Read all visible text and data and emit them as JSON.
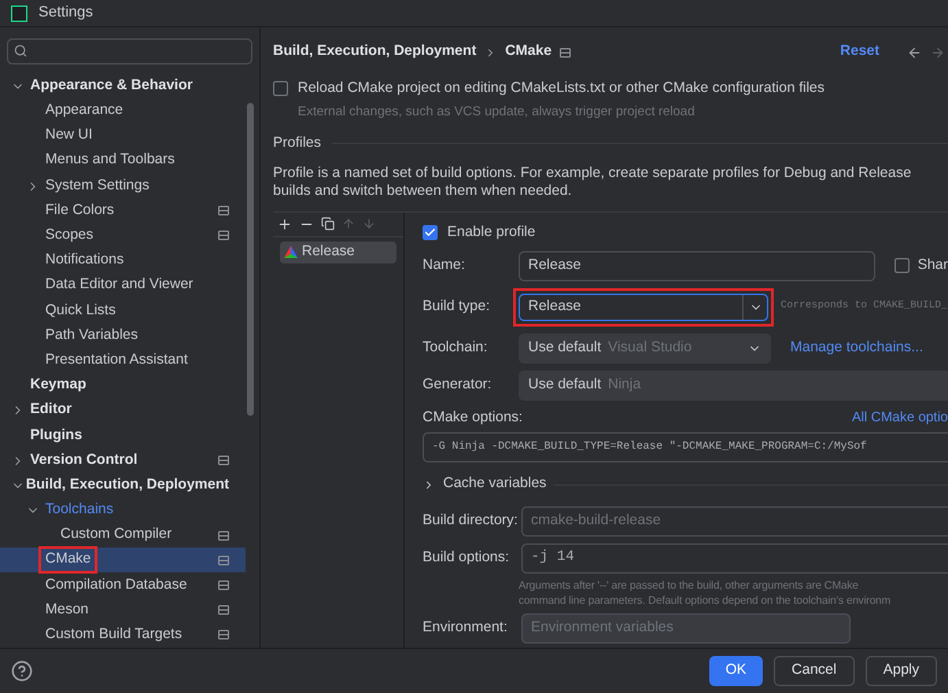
{
  "window": {
    "title": "Settings"
  },
  "sidebar": {
    "items": [
      {
        "label": "Appearance & Behavior",
        "bold": true,
        "expanded": true,
        "selected": false,
        "project": false,
        "children": [
          {
            "label": "Appearance",
            "selected": false,
            "project": false
          },
          {
            "label": "New UI",
            "selected": false,
            "project": false
          },
          {
            "label": "Menus and Toolbars",
            "selected": false,
            "project": false
          },
          {
            "label": "System Settings",
            "expanded": false,
            "selected": false,
            "project": false
          },
          {
            "label": "File Colors",
            "selected": false,
            "project": true
          },
          {
            "label": "Scopes",
            "selected": false,
            "project": true
          },
          {
            "label": "Notifications",
            "selected": false,
            "project": false
          },
          {
            "label": "Data Editor and Viewer",
            "selected": false,
            "project": false
          },
          {
            "label": "Quick Lists",
            "selected": false,
            "project": false
          },
          {
            "label": "Path Variables",
            "selected": false,
            "project": false
          },
          {
            "label": "Presentation Assistant",
            "selected": false,
            "project": false
          }
        ]
      },
      {
        "label": "Keymap",
        "bold": true,
        "selected": false,
        "project": false
      },
      {
        "label": "Editor",
        "bold": true,
        "expanded": false,
        "selected": false,
        "project": false
      },
      {
        "label": "Plugins",
        "bold": true,
        "selected": false,
        "project": false
      },
      {
        "label": "Version Control",
        "bold": true,
        "expanded": false,
        "selected": false,
        "project": true
      },
      {
        "label": "Build, Execution, Deployment",
        "bold": true,
        "expanded": true,
        "selected": false,
        "project": false,
        "children": [
          {
            "label": "Toolchains",
            "link": true,
            "expanded": true,
            "selected": false,
            "project": false,
            "children": [
              {
                "label": "Custom Compiler",
                "selected": false,
                "project": true
              }
            ]
          },
          {
            "label": "CMake",
            "selected": true,
            "highlighted": true,
            "project": true
          },
          {
            "label": "Compilation Database",
            "selected": false,
            "project": true
          },
          {
            "label": "Meson",
            "selected": false,
            "project": true
          },
          {
            "label": "Custom Build Targets",
            "selected": false,
            "project": true
          }
        ]
      }
    ]
  },
  "breadcrumb": [
    "Build, Execution, Deployment",
    "CMake"
  ],
  "reset": "Reset",
  "reload": {
    "label": "Reload CMake project on editing CMakeLists.txt or other CMake configuration files",
    "hint": "External changes, such as VCS update, always trigger project reload",
    "checked": false
  },
  "profiles": {
    "heading": "Profiles",
    "description": "Profile is a named set of build options. For example, create separate profiles for Debug and Release builds and switch between them when needed.",
    "list": [
      {
        "name": "Release",
        "selected": true
      }
    ],
    "enable_profile": {
      "label": "Enable profile",
      "checked": true
    },
    "name": {
      "label": "Name:",
      "value": "Release",
      "share_label": "Shar",
      "share_checked": false
    },
    "build_type": {
      "label": "Build type:",
      "value": "Release",
      "highlighted": true,
      "note": "Corresponds to CMAKE_BUILD_"
    },
    "toolchain": {
      "label": "Toolchain:",
      "value": "Use default",
      "hint": "Visual Studio",
      "link": "Manage toolchains..."
    },
    "generator": {
      "label": "Generator:",
      "value": "Use default",
      "hint": "Ninja"
    },
    "cmake_options": {
      "label": "CMake options:",
      "link": "All CMake optio",
      "value": "-G Ninja -DCMAKE_BUILD_TYPE=Release \"-DCMAKE_MAKE_PROGRAM=C:/MySof"
    },
    "cache_variables": {
      "label": "Cache variables",
      "expanded": false
    },
    "build_directory": {
      "label": "Build directory:",
      "placeholder": "cmake-build-release"
    },
    "build_options": {
      "label": "Build options:",
      "value": "-j 14",
      "hint_lines": [
        "Arguments after '--' are passed to the build, other arguments are CMake",
        "command line parameters. Default options depend on the toolchain's environm"
      ]
    },
    "environment": {
      "label": "Environment:",
      "placeholder": "Environment variables"
    }
  },
  "buttons": [
    {
      "label": "OK",
      "kind": "primary"
    },
    {
      "label": "Cancel",
      "kind": "secondary"
    },
    {
      "label": "Apply",
      "kind": "secondary"
    }
  ]
}
